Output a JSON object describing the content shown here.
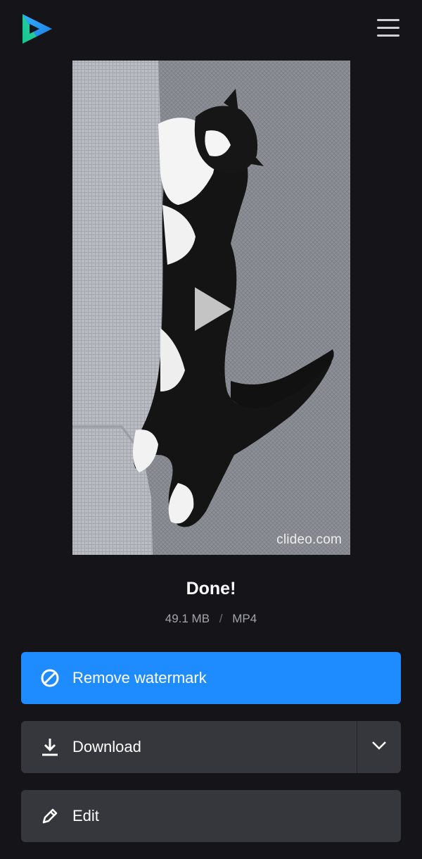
{
  "app": {
    "logo_icon": "clideo-play-logo-icon",
    "menu_icon": "hamburger-menu-icon"
  },
  "video": {
    "watermark": "clideo.com",
    "play_icon": "play-icon"
  },
  "result": {
    "title": "Done!",
    "file_size": "49.1 MB",
    "separator": "/",
    "format": "MP4"
  },
  "actions": {
    "remove_watermark": {
      "label": "Remove watermark",
      "icon": "no-symbol-icon",
      "color": "#1e8bff"
    },
    "download": {
      "label": "Download",
      "icon": "download-icon",
      "toggle_icon": "chevron-down-icon"
    },
    "edit": {
      "label": "Edit",
      "icon": "pencil-icon"
    }
  }
}
